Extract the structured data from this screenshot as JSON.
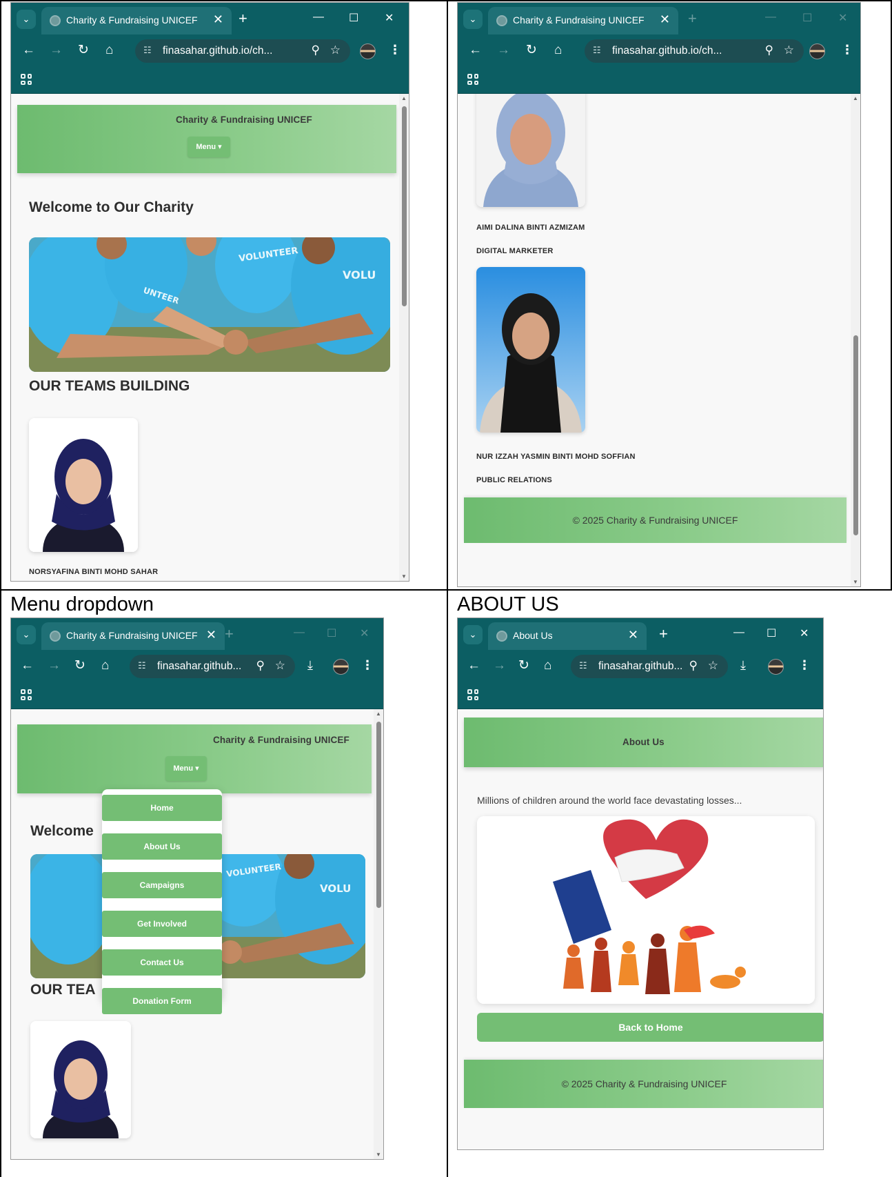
{
  "captions": {
    "menu_dropdown": "Menu dropdown",
    "about_us": "ABOUT US"
  },
  "browser": {
    "tab_title": "Charity & Fundraising UNICEF",
    "about_tab_title": "About Us",
    "url_full": "finasahar.github.io/ch...",
    "url_short": "finasahar.github...",
    "url_mid": "finasahar.github.io/ch...",
    "icons": [
      "tab-search-icon",
      "new-tab-icon",
      "minimize-icon",
      "maximize-icon",
      "close-icon",
      "back-icon",
      "forward-icon",
      "reload-icon",
      "home-icon",
      "site-settings-icon",
      "zoom-icon",
      "bookmark-star-icon",
      "profile-avatar-icon",
      "more-menu-icon",
      "download-icon",
      "apps-grid-icon"
    ]
  },
  "site": {
    "title": "Charity & Fundraising UNICEF",
    "menu_label": "Menu ▾",
    "welcome_heading": "Welcome to Our Charity",
    "welcome_heading_cut": "Welcome",
    "teams_heading": "OUR TEAMS BUILDING",
    "teams_heading_cut": "OUR TEA",
    "footer": "© 2025 Charity & Fundraising UNICEF",
    "accent": "#74be74",
    "header_gradient": [
      "#6dbb6f",
      "#a5d7a3"
    ],
    "chrome_color": "#0c5e63"
  },
  "team": [
    {
      "name": "NORSYAFINA BINTI MOHD SAHAR",
      "role": ""
    },
    {
      "name": "AIMI DALINA BINTI AZMIZAM",
      "role": "DIGITAL MARKETER"
    },
    {
      "name": "NUR IZZAH YASMIN BINTI MOHD SOFFIAN",
      "role": "PUBLIC RELATIONS"
    }
  ],
  "menu_items": [
    "Home",
    "About Us",
    "Campaigns",
    "Get Involved",
    "Contact Us",
    "Donation Form"
  ],
  "about": {
    "heading": "About Us",
    "intro": "Millions of children around the world face devastating losses...",
    "back_button": "Back to Home"
  }
}
